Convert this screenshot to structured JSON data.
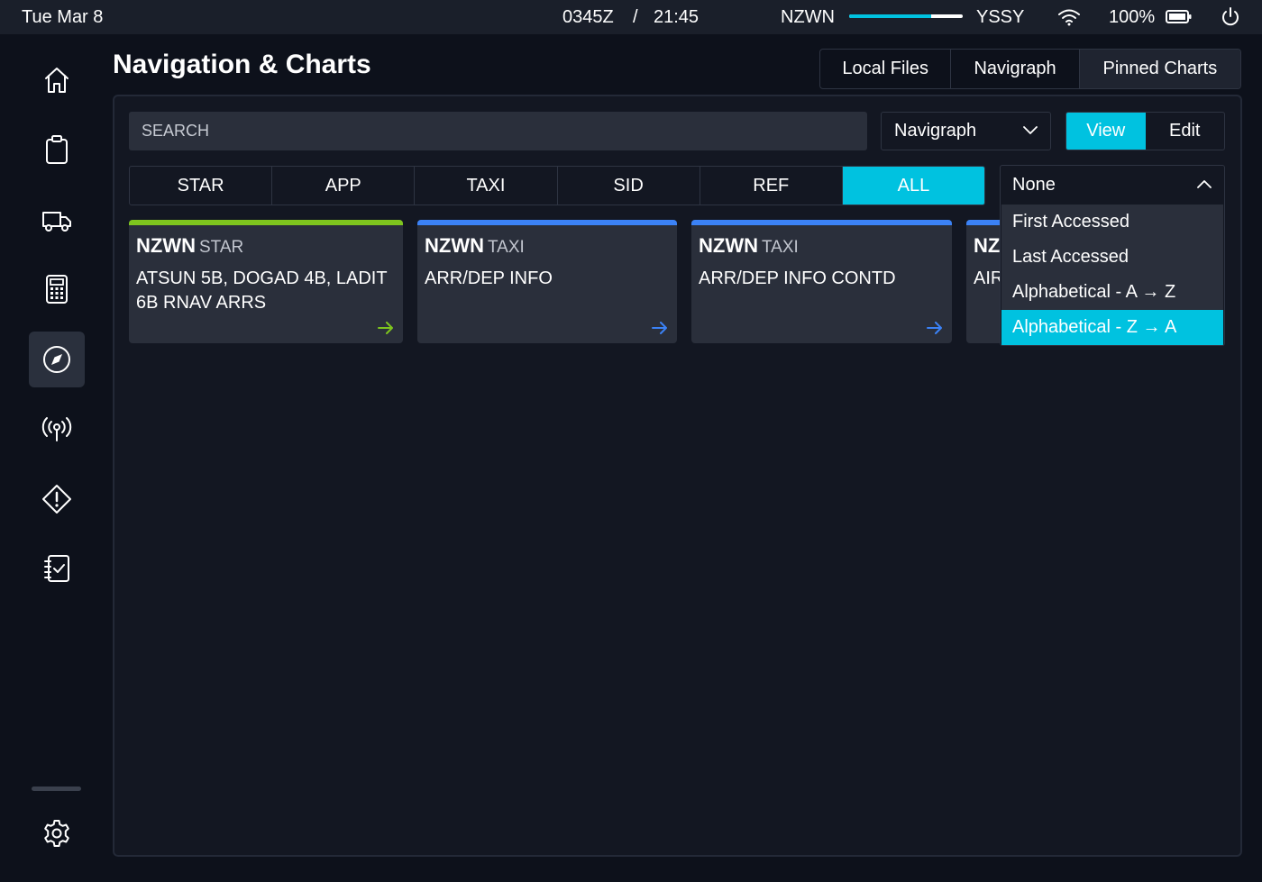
{
  "status": {
    "date": "Tue Mar 8",
    "zulu_time": "0345Z",
    "separator": "/",
    "local_time": "21:45",
    "origin": "NZWN",
    "destination": "YSSY",
    "flight_progress_fraction": 0.72,
    "battery": "100%",
    "icons": [
      "wifi-icon",
      "battery-icon",
      "power-icon"
    ]
  },
  "sidebar": {
    "items": [
      {
        "name": "home",
        "icon": "home-icon"
      },
      {
        "name": "dispatch",
        "icon": "clipboard-icon"
      },
      {
        "name": "ground",
        "icon": "truck-icon"
      },
      {
        "name": "performance",
        "icon": "calculator-icon"
      },
      {
        "name": "navigation",
        "icon": "compass-icon",
        "active": true
      },
      {
        "name": "atc",
        "icon": "radio-tower-icon"
      },
      {
        "name": "failures",
        "icon": "warning-icon"
      },
      {
        "name": "checklists",
        "icon": "checklist-icon"
      }
    ],
    "settings_icon": "gear-icon"
  },
  "page": {
    "title": "Navigation & Charts"
  },
  "source_tabs": [
    "Local Files",
    "Navigraph",
    "Pinned Charts"
  ],
  "search": {
    "placeholder": "SEARCH"
  },
  "provider": {
    "selected": "Navigraph"
  },
  "mode": {
    "view": "View",
    "edit": "Edit",
    "active": "View"
  },
  "category_tabs": [
    "STAR",
    "APP",
    "TAXI",
    "SID",
    "REF",
    "ALL"
  ],
  "active_category": "ALL",
  "cards": [
    {
      "icao": "NZWN",
      "type": "STAR",
      "lines": [
        "ATSUN 5B, DOGAD 4B, LADIT",
        "6B RNAV ARRS"
      ],
      "color": "#7ec51e"
    },
    {
      "icao": "NZWN",
      "type": "TAXI",
      "lines": [
        "ARR/DEP INFO",
        ""
      ],
      "color": "#3b82f6"
    },
    {
      "icao": "NZWN",
      "type": "TAXI",
      "lines": [
        "ARR/DEP INFO CONTD",
        ""
      ],
      "color": "#3b82f6"
    },
    {
      "icao": "NZ",
      "type": "",
      "lines": [
        "AIR",
        ""
      ],
      "color": "#3b82f6"
    }
  ],
  "sort": {
    "selected": "None",
    "options": [
      "First Accessed",
      "Last Accessed",
      "Alphabetical - A → Z",
      "Alphabetical - Z → A"
    ],
    "highlighted": "Alphabetical - Z → A"
  },
  "colors": {
    "accent": "#00c2e0",
    "background": "#0d111b",
    "surface": "#2a2f3b",
    "star_green": "#7ec51e",
    "taxi_blue": "#3b82f6"
  }
}
